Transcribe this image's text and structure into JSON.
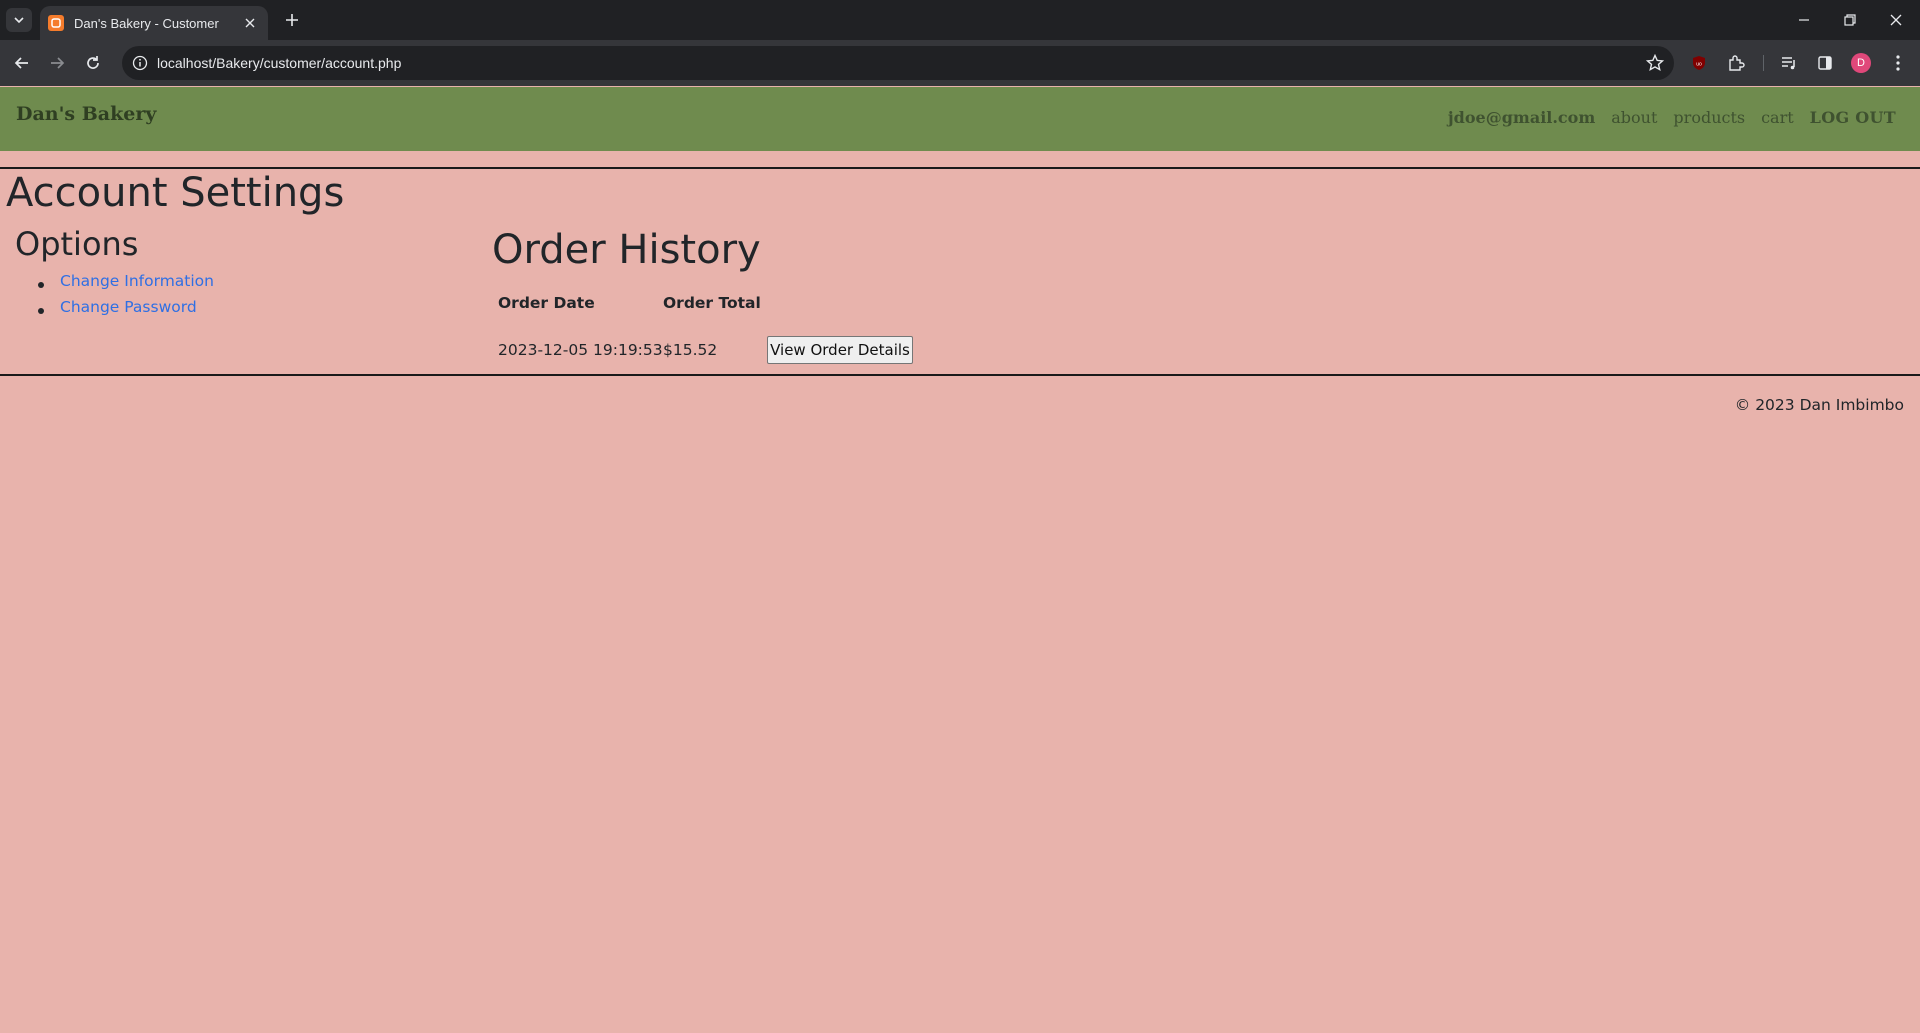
{
  "browser": {
    "tab_title": "Dan's Bakery - Customer",
    "url": "localhost/Bakery/customer/account.php",
    "profile_initial": "D"
  },
  "site": {
    "brand": "Dan's Bakery",
    "nav": {
      "user_email": "jdoe@gmail.com",
      "about": "about",
      "products": "products",
      "cart": "cart",
      "logout": "LOG OUT"
    }
  },
  "account": {
    "heading": "Account Settings",
    "options": {
      "heading": "Options",
      "items": [
        "Change Information",
        "Change Password"
      ]
    },
    "orders": {
      "heading": "Order History",
      "columns": [
        "Order Date",
        "Order Total"
      ],
      "rows": [
        {
          "date": "2023-12-05 19:19:53",
          "total": "$15.52",
          "action": "View Order Details"
        }
      ]
    }
  },
  "footer": {
    "copyright": "© 2023 Dan Imbimbo"
  },
  "colors": {
    "page_background": "#e8b3ac",
    "header_background": "#6f8b4e",
    "link": "#2f6fe4"
  }
}
